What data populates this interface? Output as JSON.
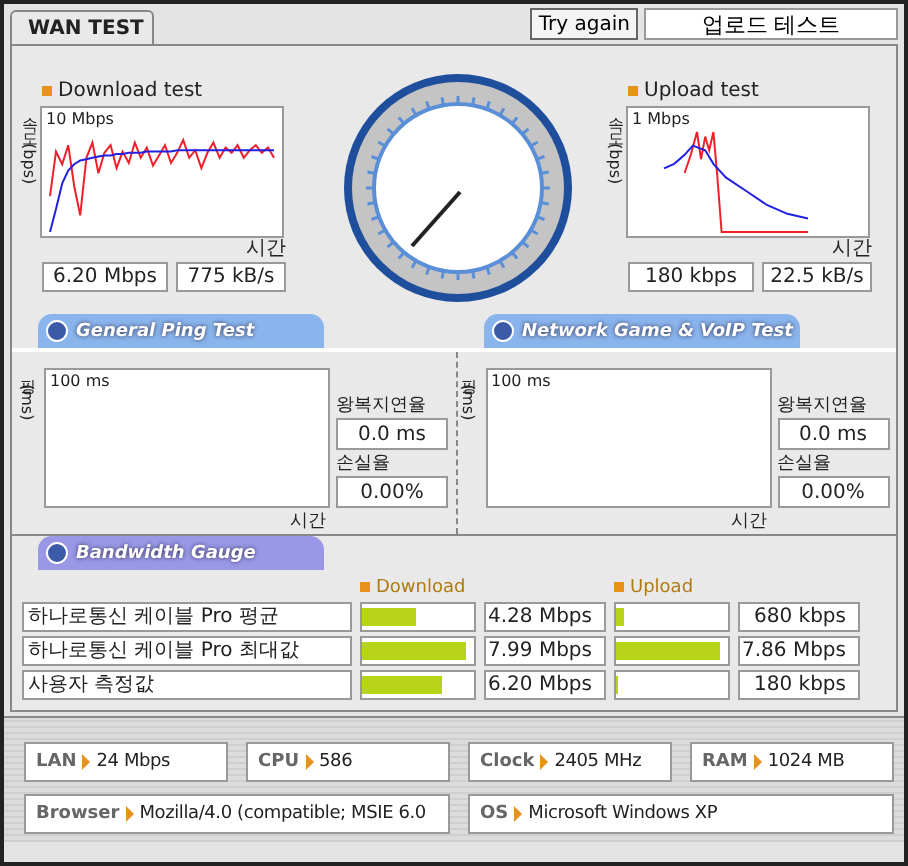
{
  "tab": {
    "label": "WAN TEST",
    "selected": true
  },
  "toolbar": {
    "button": "Try again",
    "field_value": "업로드 테스트"
  },
  "speed_tests": [
    {
      "kind": "download",
      "title": "Download test",
      "y_label": "속도 (bps)",
      "scale": "10 Mbps",
      "x_label": "시간",
      "readings": [
        "6.20 Mbps",
        "775 kB/s"
      ]
    },
    {
      "kind": "upload",
      "title": "Upload test",
      "y_label": "속도 (bps)",
      "scale": "1 Mbps",
      "x_label": "시간",
      "readings": [
        "180 kbps",
        "22.5 kB/s"
      ]
    }
  ],
  "ping_tests": [
    {
      "title": "General Ping Test",
      "y_label": "핑(ms)",
      "scale": "100 ms",
      "x_label": "시간",
      "latency_label": "왕복지연율",
      "latency": "0.0 ms",
      "loss_label": "손실율",
      "loss": "0.00%"
    },
    {
      "title": "Network Game & VoIP Test",
      "y_label": "핑(ms)",
      "scale": "100 ms",
      "x_label": "시간",
      "latency_label": "왕복지연율",
      "latency": "0.0 ms",
      "loss_label": "손실율",
      "loss": "0.00%"
    }
  ],
  "bandwidth": {
    "title": "Bandwidth Gauge",
    "download_header": "Download",
    "upload_header": "Upload",
    "rows": [
      {
        "name": "하나로통신 케이블 Pro 평균",
        "download": {
          "level": 0.49,
          "reading": "4.28 Mbps"
        },
        "upload": {
          "level": 0.07,
          "reading": "680 kbps"
        }
      },
      {
        "name": "하나로통신 케이블 Pro 최대값",
        "download": {
          "level": 0.93,
          "reading": "7.99 Mbps"
        },
        "upload": {
          "level": 0.93,
          "reading": "7.86 Mbps"
        }
      },
      {
        "name": "사용자 측정값",
        "download": {
          "level": 0.72,
          "reading": "6.20 Mbps"
        },
        "upload": {
          "level": 0.02,
          "reading": "180 kbps"
        }
      }
    ]
  },
  "system_info": [
    {
      "label": "LAN",
      "value": "24 Mbps"
    },
    {
      "label": "CPU",
      "value": "586"
    },
    {
      "label": "Clock",
      "value": "2405 MHz"
    },
    {
      "label": "RAM",
      "value": "1024 MB"
    },
    {
      "label": "Browser",
      "value": "Mozilla/4.0 (compatible; MSIE 6.0"
    },
    {
      "label": "OS",
      "value": "Microsoft Windows XP"
    }
  ]
}
